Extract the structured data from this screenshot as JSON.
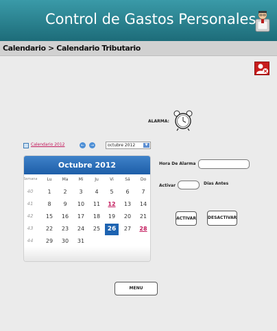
{
  "header": {
    "title": "Control de Gastos Personales"
  },
  "breadcrumb": {
    "text": "Calendario > Calendario Tributario"
  },
  "alarm": {
    "label": "ALARMA:"
  },
  "calendar": {
    "link_label": "Calendario 2012",
    "prev_arrow": "←",
    "next_arrow": "→",
    "month_select_value": "octubre 2012",
    "title": "Octubre 2012",
    "weekday_headers": [
      "Semana",
      "Lu",
      "Ma",
      "Mi",
      "Ju",
      "Vi",
      "Sá",
      "Do"
    ],
    "weeks": [
      {
        "week": "40",
        "days": [
          "1",
          "2",
          "3",
          "4",
          "5",
          "6",
          "7"
        ]
      },
      {
        "week": "41",
        "days": [
          "8",
          "9",
          "10",
          "11",
          "12",
          "13",
          "14"
        ]
      },
      {
        "week": "42",
        "days": [
          "15",
          "16",
          "17",
          "18",
          "19",
          "20",
          "21"
        ]
      },
      {
        "week": "43",
        "days": [
          "22",
          "23",
          "24",
          "25",
          "26",
          "27",
          "28"
        ]
      },
      {
        "week": "44",
        "days": [
          "29",
          "30",
          "31",
          "",
          "",
          "",
          ""
        ]
      }
    ],
    "highlighted_days": [
      "12",
      "28"
    ],
    "selected_day": "26"
  },
  "form": {
    "hora_label": "Hora De Alarma",
    "hora_value": "",
    "activar_label": "Activar",
    "activar_value": "",
    "dias_label": "Días Antes"
  },
  "buttons": {
    "activar": "ACTIVAR",
    "desactivar": "DESACTIVAR",
    "menu": "MENU"
  },
  "colors": {
    "header_bg": "#1d6c79",
    "calendar_header": "#1d5ea8",
    "highlight": "#c2185b",
    "selected": "#1d63b1"
  }
}
